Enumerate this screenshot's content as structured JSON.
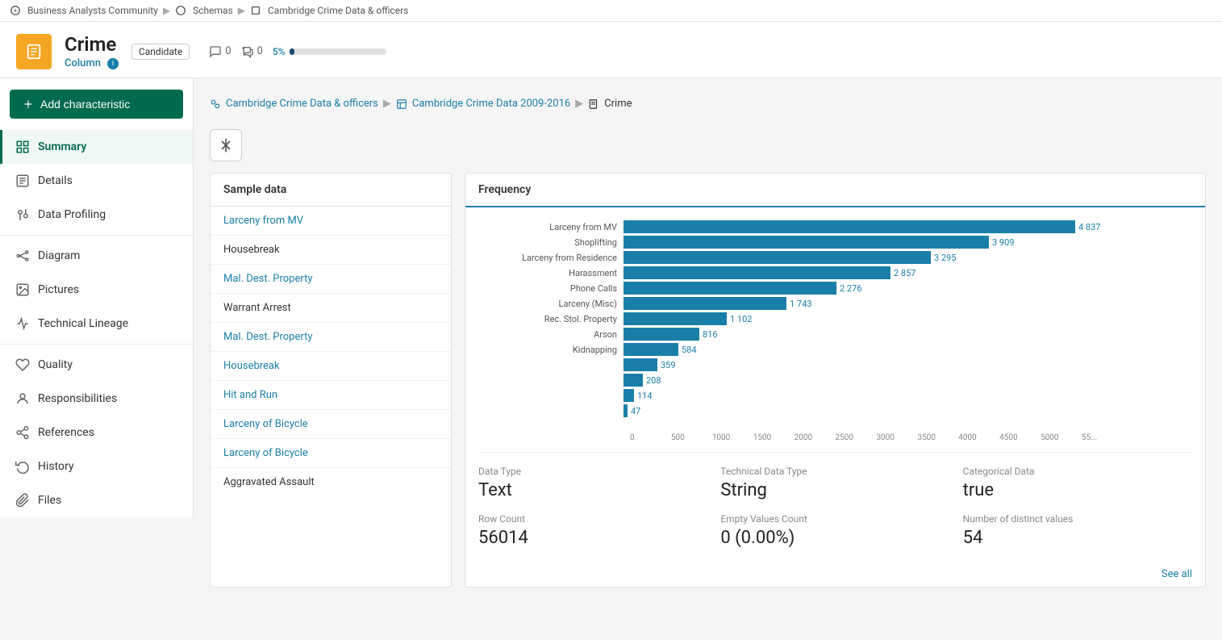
{
  "breadcrumb": {
    "community": "Business Analysts Community",
    "schemas": "Schemas",
    "dataset": "Cambridge Crime Data & officers"
  },
  "header": {
    "title": "Crime",
    "asset_type": "Column",
    "badge": "Candidate",
    "comments_count": "0",
    "chat_count": "0",
    "progress_label": "5%",
    "progress_value": 5
  },
  "add_char_btn": "Add characteristic",
  "collapse_icon": "‹",
  "nav": [
    {
      "id": "summary",
      "label": "Summary",
      "icon": "summary",
      "active": true
    },
    {
      "id": "details",
      "label": "Details",
      "icon": "details",
      "active": false
    },
    {
      "id": "data-profiling",
      "label": "Data Profiling",
      "icon": "profiling",
      "active": false
    },
    {
      "id": "diagram",
      "label": "Diagram",
      "icon": "diagram",
      "active": false
    },
    {
      "id": "pictures",
      "label": "Pictures",
      "icon": "pictures",
      "active": false
    },
    {
      "id": "technical-lineage",
      "label": "Technical Lineage",
      "icon": "lineage",
      "active": false
    },
    {
      "id": "quality",
      "label": "Quality",
      "icon": "quality",
      "active": false
    },
    {
      "id": "responsibilities",
      "label": "Responsibilities",
      "icon": "responsibilities",
      "active": false
    },
    {
      "id": "references",
      "label": "References",
      "icon": "references",
      "active": false
    },
    {
      "id": "history",
      "label": "History",
      "icon": "history",
      "active": false
    },
    {
      "id": "files",
      "label": "Files",
      "icon": "files",
      "active": false
    }
  ],
  "sub_breadcrumb": {
    "part1": "Cambridge Crime Data & officers",
    "part2": "Cambridge Crime Data 2009-2016",
    "part3": "Crime"
  },
  "sample_data": {
    "header": "Sample data",
    "items": [
      {
        "label": "Larceny from MV",
        "dark": false
      },
      {
        "label": "Housebreak",
        "dark": true
      },
      {
        "label": "Mal. Dest. Property",
        "dark": false
      },
      {
        "label": "Warrant Arrest",
        "dark": true
      },
      {
        "label": "Mal. Dest. Property",
        "dark": false
      },
      {
        "label": "Housebreak",
        "dark": false
      },
      {
        "label": "Hit and Run",
        "dark": false
      },
      {
        "label": "Larceny of Bicycle",
        "dark": false
      },
      {
        "label": "Larceny of Bicycle",
        "dark": false
      },
      {
        "label": "Aggravated Assault",
        "dark": true
      }
    ]
  },
  "frequency": {
    "tab_label": "Frequency",
    "bars": [
      {
        "label": "Larceny from MV",
        "value": 4837,
        "display": "4 837",
        "width_pct": 100
      },
      {
        "label": "Shoplifting",
        "value": 3909,
        "display": "3 909",
        "width_pct": 80
      },
      {
        "label": "Larceny from Residence",
        "value": 3295,
        "display": "3 295",
        "width_pct": 68
      },
      {
        "label": "Harassment",
        "value": 2857,
        "display": "2 857",
        "width_pct": 59
      },
      {
        "label": "Phone Calls",
        "value": 2276,
        "display": "2 276",
        "width_pct": 47
      },
      {
        "label": "Larceny (Misc)",
        "value": 1743,
        "display": "1 743",
        "width_pct": 36
      },
      {
        "label": "Rec. Stol. Property",
        "value": 1102,
        "display": "1 102",
        "width_pct": 23
      },
      {
        "label": "Arson",
        "value": 816,
        "display": "816",
        "width_pct": 17
      },
      {
        "label": "Kidnapping",
        "value": 584,
        "display": "584",
        "width_pct": 12
      },
      {
        "label": "",
        "value": 359,
        "display": "359",
        "width_pct": 7.4
      },
      {
        "label": "",
        "value": 208,
        "display": "208",
        "width_pct": 4.3
      },
      {
        "label": "",
        "value": 114,
        "display": "114",
        "width_pct": 2.4
      },
      {
        "label": "",
        "value": 47,
        "display": "47",
        "width_pct": 1.0
      }
    ],
    "x_ticks": [
      "0",
      "500",
      "1000",
      "1500",
      "2000",
      "2500",
      "3000",
      "3500",
      "4000",
      "4500",
      "5000",
      "55..."
    ]
  },
  "stats": [
    {
      "label": "Data Type",
      "value": "Text"
    },
    {
      "label": "Technical Data Type",
      "value": "String"
    },
    {
      "label": "Categorical Data",
      "value": "true"
    },
    {
      "label": "Row Count",
      "value": "56014"
    },
    {
      "label": "Empty Values Count",
      "value": "0 (0.00%)"
    },
    {
      "label": "Number of distinct values",
      "value": "54"
    }
  ],
  "see_all": "See all"
}
